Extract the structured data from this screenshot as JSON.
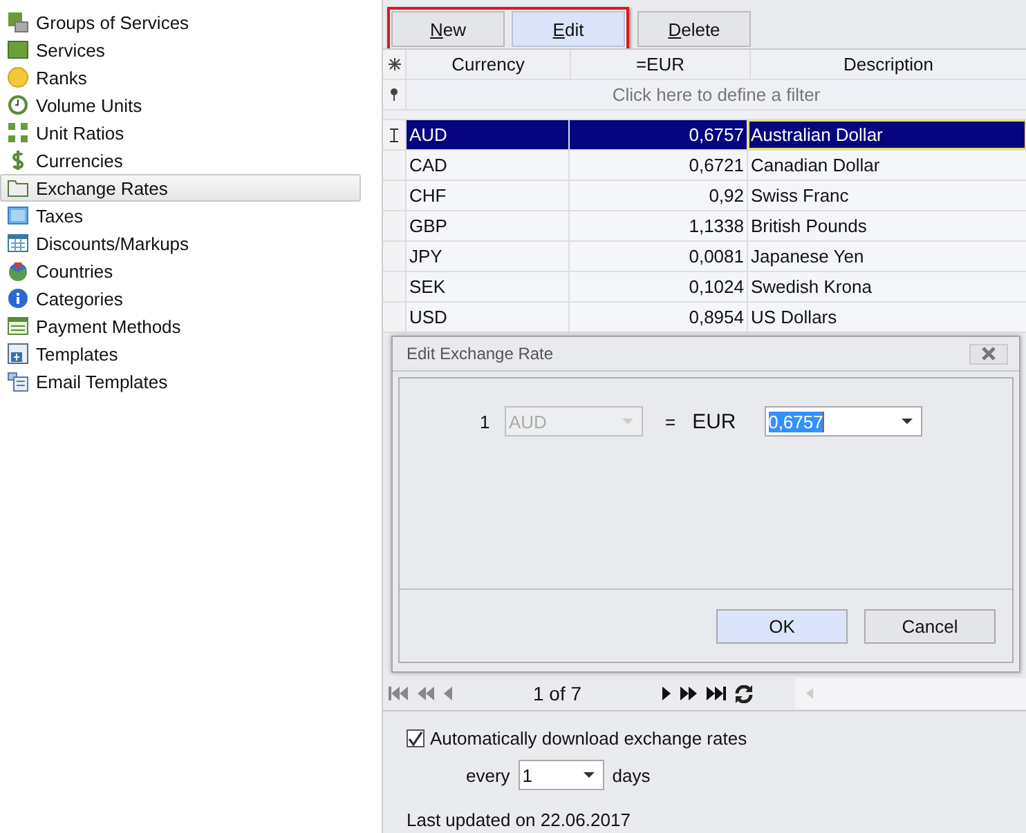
{
  "sidebar": {
    "items": [
      {
        "label": "Groups of Services",
        "selected": false
      },
      {
        "label": "Services",
        "selected": false
      },
      {
        "label": "Ranks",
        "selected": false
      },
      {
        "label": "Volume Units",
        "selected": false
      },
      {
        "label": "Unit Ratios",
        "selected": false
      },
      {
        "label": "Currencies",
        "selected": false
      },
      {
        "label": "Exchange Rates",
        "selected": true
      },
      {
        "label": "Taxes",
        "selected": false
      },
      {
        "label": "Discounts/Markups",
        "selected": false
      },
      {
        "label": "Countries",
        "selected": false
      },
      {
        "label": "Categories",
        "selected": false
      },
      {
        "label": "Payment Methods",
        "selected": false
      },
      {
        "label": "Templates",
        "selected": false
      },
      {
        "label": "Email Templates",
        "selected": false
      }
    ]
  },
  "toolbar": {
    "highlighted_group": [
      {
        "label": "New",
        "hovered": false
      },
      {
        "label": "Edit",
        "hovered": true
      }
    ],
    "buttons": [
      {
        "label": "Delete",
        "hovered": false
      }
    ]
  },
  "grid": {
    "columns": [
      "Currency",
      "=EUR",
      "Description"
    ],
    "filter_placeholder": "Click here to define a filter",
    "rows": [
      {
        "currency": "AUD",
        "rate": "0,6757",
        "description": "Australian Dollar",
        "selected": true
      },
      {
        "currency": "CAD",
        "rate": "0,6721",
        "description": "Canadian Dollar",
        "selected": false
      },
      {
        "currency": "CHF",
        "rate": "0,92",
        "description": "Swiss Franc",
        "selected": false
      },
      {
        "currency": "GBP",
        "rate": "1,1338",
        "description": "British Pounds",
        "selected": false
      },
      {
        "currency": "JPY",
        "rate": "0,0081",
        "description": "Japanese Yen",
        "selected": false
      },
      {
        "currency": "SEK",
        "rate": "0,1024",
        "description": "Swedish Krona",
        "selected": false
      },
      {
        "currency": "USD",
        "rate": "0,8954",
        "description": "US Dollars",
        "selected": false
      }
    ]
  },
  "dialog": {
    "title": "Edit Exchange Rate",
    "amount": "1",
    "from_currency": "AUD",
    "from_disabled": true,
    "equals": "=",
    "to_currency": "EUR",
    "rate_value": "0,6757",
    "buttons": [
      {
        "label": "OK",
        "default": true
      },
      {
        "label": "Cancel",
        "default": false
      }
    ]
  },
  "navigator": {
    "position": "1 of 7"
  },
  "settings": {
    "auto_download": {
      "label": "Automatically download exchange rates",
      "checked": true
    },
    "every_label": "every",
    "interval": "1",
    "days_label": "days",
    "last_updated": "Last updated on 22.06.2017"
  }
}
